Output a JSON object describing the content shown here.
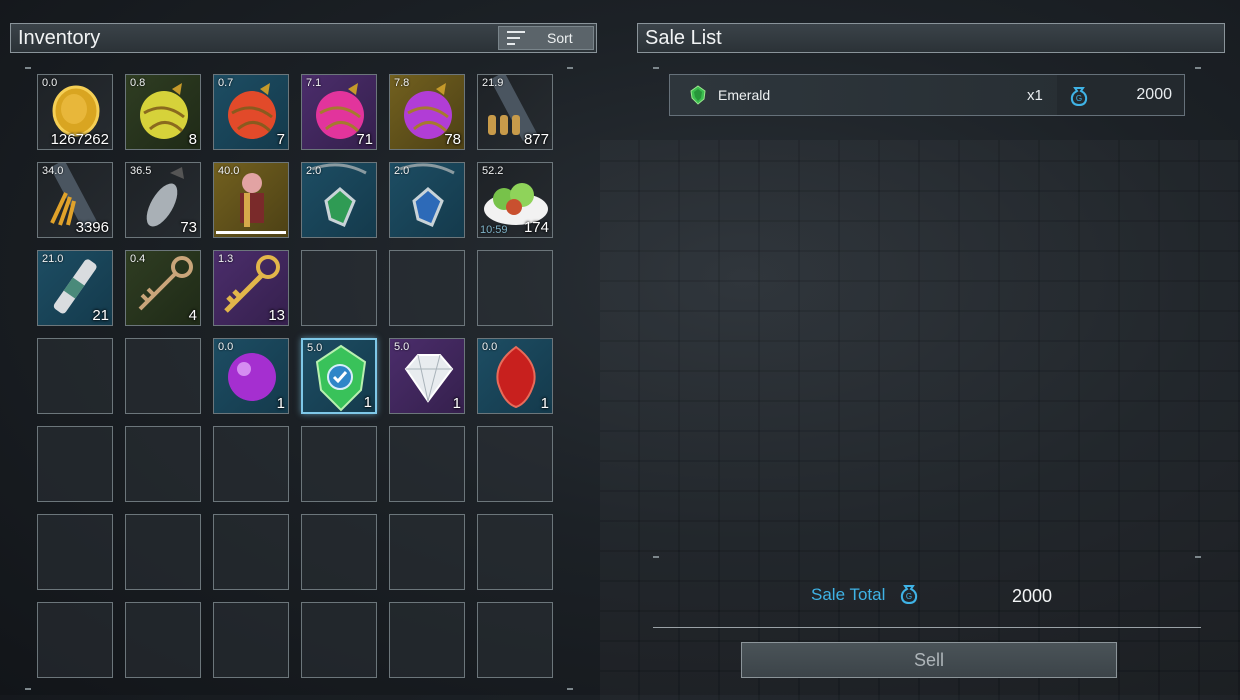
{
  "inventory": {
    "title": "Inventory",
    "sort_label": "Sort",
    "slots": [
      {
        "weight": "0.0",
        "qty": "1267262",
        "rarity": "gray",
        "icon": "gold-coin-icon"
      },
      {
        "weight": "0.8",
        "qty": "8",
        "rarity": "green",
        "icon": "yellow-sphere-icon"
      },
      {
        "weight": "0.7",
        "qty": "7",
        "rarity": "blue",
        "icon": "red-sphere-icon"
      },
      {
        "weight": "7.1",
        "qty": "71",
        "rarity": "purple",
        "icon": "pink-sphere-icon"
      },
      {
        "weight": "7.8",
        "qty": "78",
        "rarity": "gold",
        "icon": "purple-sphere-icon"
      },
      {
        "weight": "21.9",
        "qty": "877",
        "rarity": "gray",
        "icon": "ammo-icon"
      },
      {
        "weight": "34.0",
        "qty": "3396",
        "rarity": "gray",
        "icon": "arrows-icon"
      },
      {
        "weight": "36.5",
        "qty": "73",
        "rarity": "gray",
        "icon": "rocket-icon"
      },
      {
        "weight": "40.0",
        "qty": "",
        "rarity": "gold",
        "icon": "armor-figure-icon",
        "bar": 1.0
      },
      {
        "weight": "2.0",
        "qty": "",
        "rarity": "blue",
        "icon": "green-pendant-icon"
      },
      {
        "weight": "2.0",
        "qty": "",
        "rarity": "blue",
        "icon": "blue-pendant-icon"
      },
      {
        "weight": "52.2",
        "qty": "174",
        "rarity": "gray",
        "icon": "salad-icon",
        "timer": "10:59"
      },
      {
        "weight": "21.0",
        "qty": "21",
        "rarity": "blue",
        "icon": "spark-plug-icon"
      },
      {
        "weight": "0.4",
        "qty": "4",
        "rarity": "green",
        "icon": "old-key-icon"
      },
      {
        "weight": "1.3",
        "qty": "13",
        "rarity": "purple",
        "icon": "gold-key-icon"
      },
      {
        "weight": "",
        "qty": "",
        "rarity": "empty",
        "icon": ""
      },
      {
        "weight": "",
        "qty": "",
        "rarity": "empty",
        "icon": ""
      },
      {
        "weight": "",
        "qty": "",
        "rarity": "empty",
        "icon": ""
      },
      {
        "weight": "",
        "qty": "",
        "rarity": "empty",
        "icon": ""
      },
      {
        "weight": "",
        "qty": "",
        "rarity": "empty",
        "icon": ""
      },
      {
        "weight": "0.0",
        "qty": "1",
        "rarity": "blue",
        "icon": "purple-orb-icon"
      },
      {
        "weight": "5.0",
        "qty": "1",
        "rarity": "blue",
        "icon": "emerald-icon",
        "selected": true
      },
      {
        "weight": "5.0",
        "qty": "1",
        "rarity": "purple",
        "icon": "diamond-icon"
      },
      {
        "weight": "0.0",
        "qty": "1",
        "rarity": "blue",
        "icon": "ruby-icon"
      }
    ],
    "total_slots": 42
  },
  "sale_list": {
    "title": "Sale List",
    "items": [
      {
        "name": "Emerald",
        "count": "x1",
        "price": "2000",
        "icon": "emerald-icon"
      }
    ],
    "total_label": "Sale Total",
    "total_value": "2000",
    "sell_label": "Sell"
  },
  "colors": {
    "accent": "#3fb3e6",
    "selected_border": "#7fc8e8"
  }
}
